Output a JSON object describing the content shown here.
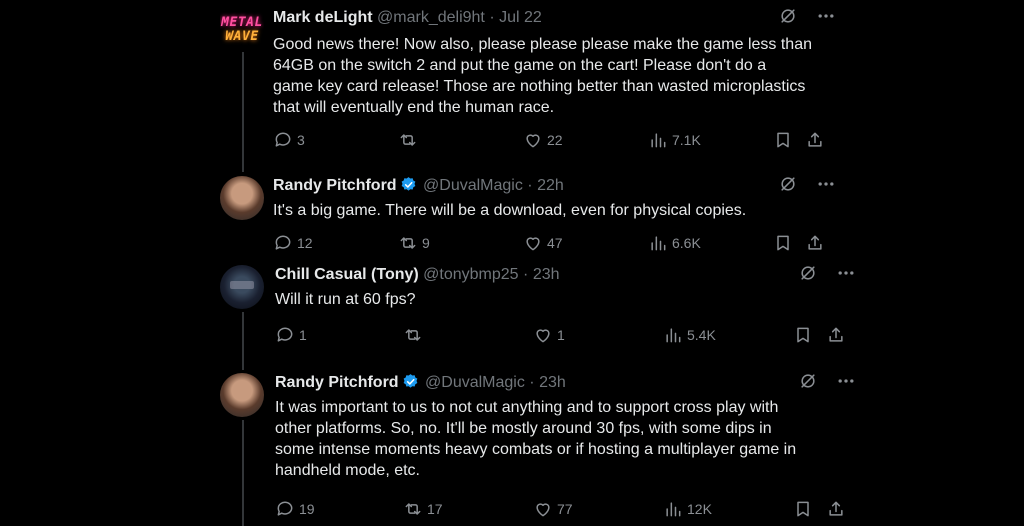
{
  "tweets": [
    {
      "avatar_text": [
        "METAL",
        "WAVE"
      ],
      "name": "Mark deLight",
      "handle": "@mark_deli9ht",
      "sep": "·",
      "time": "Jul 22",
      "verified": false,
      "lines": [
        "Good news there!  Now also, please please please make the game less than",
        "64GB on the switch 2 and put the game on the cart!  Please don't do a",
        "game key card release!  Those are nothing better than wasted microplastics",
        "that will eventually end the human race."
      ],
      "replies": "3",
      "reposts": "",
      "likes": "22",
      "views": "7.1K"
    },
    {
      "name": "Randy Pitchford",
      "handle": "@DuvalMagic",
      "sep": "·",
      "time": "22h",
      "verified": true,
      "lines": [
        "It's a big game. There will be a download, even for physical copies."
      ],
      "replies": "12",
      "reposts": "9",
      "likes": "47",
      "views": "6.6K"
    },
    {
      "name": "Chill Casual (Tony)",
      "handle": "@tonybmp25",
      "sep": "·",
      "time": "23h",
      "verified": false,
      "lines": [
        "Will it run at 60 fps?"
      ],
      "replies": "1",
      "reposts": "",
      "likes": "1",
      "views": "5.4K"
    },
    {
      "name": "Randy Pitchford",
      "handle": "@DuvalMagic",
      "sep": "·",
      "time": "23h",
      "verified": true,
      "lines": [
        "It was important to us to not cut anything and to support cross play with",
        "other platforms.  So, no. It'll be mostly around 30 fps, with some dips in",
        "some intense moments heavy combats or if hosting a multiplayer game in",
        "handheld mode, etc."
      ],
      "replies": "19",
      "reposts": "17",
      "likes": "77",
      "views": "12K"
    }
  ],
  "colors": {
    "background": "#000000",
    "text": "#e7e9ea",
    "muted": "#71767b",
    "verified": "#1d9bf0"
  }
}
